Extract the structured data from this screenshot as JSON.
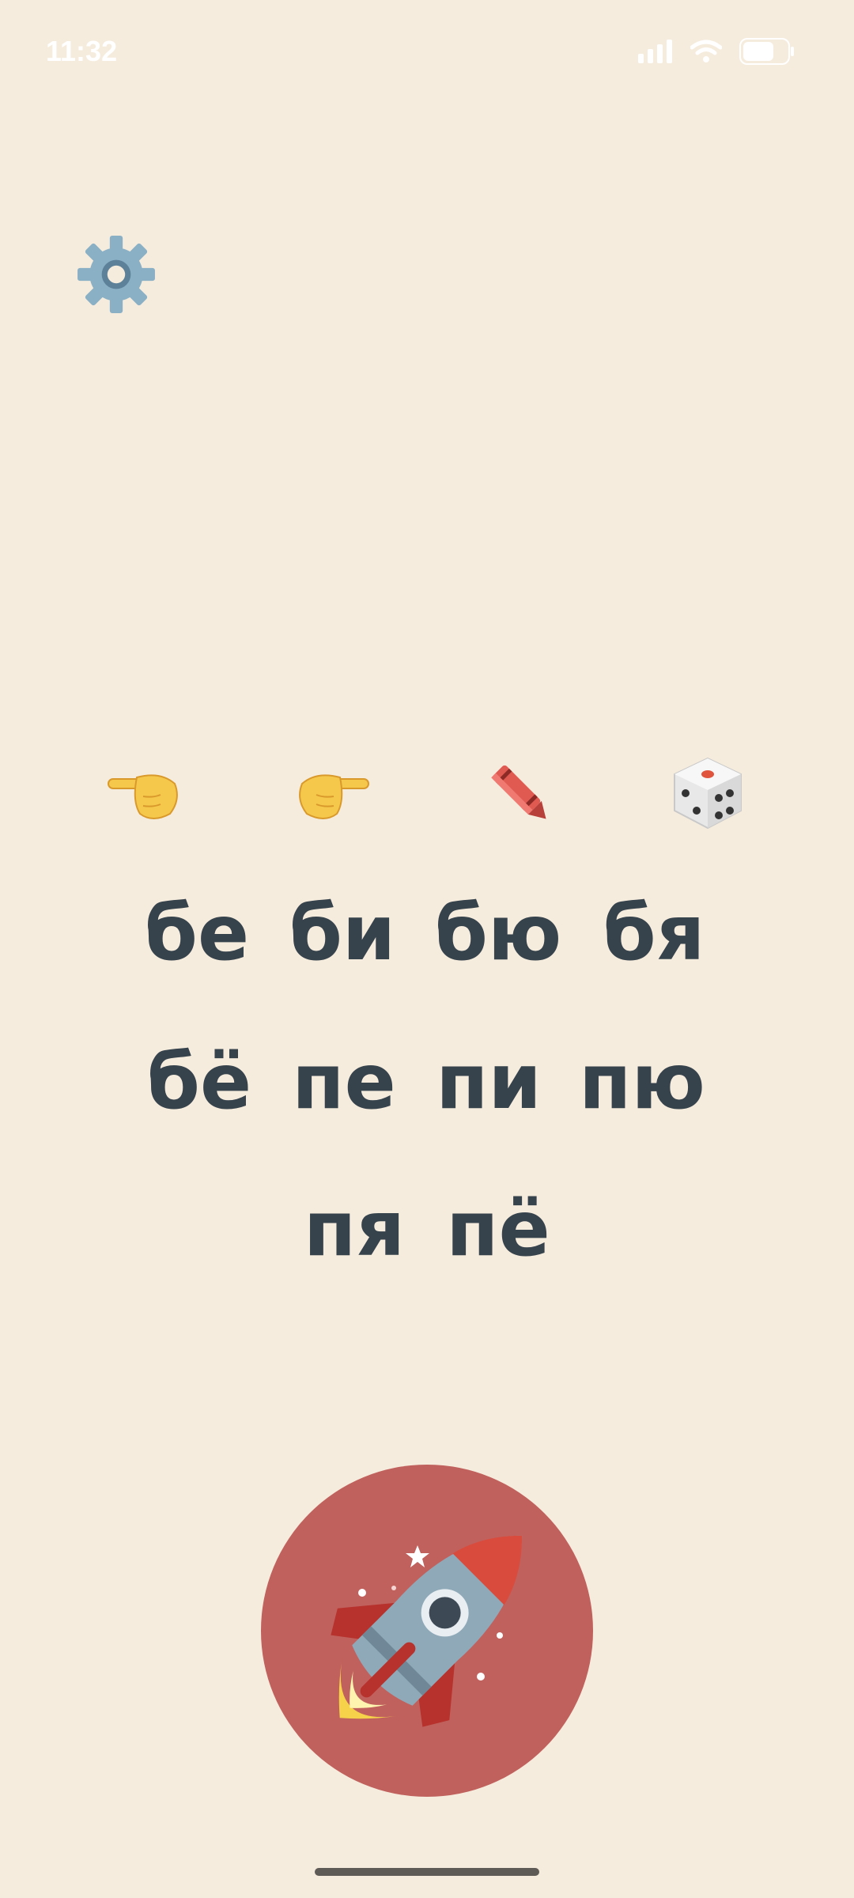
{
  "status_bar": {
    "time": "11:32",
    "icons": [
      "signal-icon",
      "wifi-icon",
      "battery-icon"
    ]
  },
  "settings": {
    "icon": "gear-icon"
  },
  "tools": [
    {
      "name": "pointing-hand-left-icon"
    },
    {
      "name": "pointing-hand-right-icon"
    },
    {
      "name": "crayon-icon"
    },
    {
      "name": "dice-icon"
    }
  ],
  "syllables": {
    "row1": [
      "бе",
      "би",
      "бю",
      "бя"
    ],
    "row2": [
      "бё",
      "пе",
      "пи",
      "пю"
    ],
    "row3": [
      "пя",
      "пё"
    ]
  },
  "launch": {
    "icon": "rocket-icon"
  },
  "colors": {
    "background": "#f6ecdd",
    "syllable_text": "#36424c",
    "launch_button": "#c0615d",
    "gear": "#8ab0c6"
  }
}
